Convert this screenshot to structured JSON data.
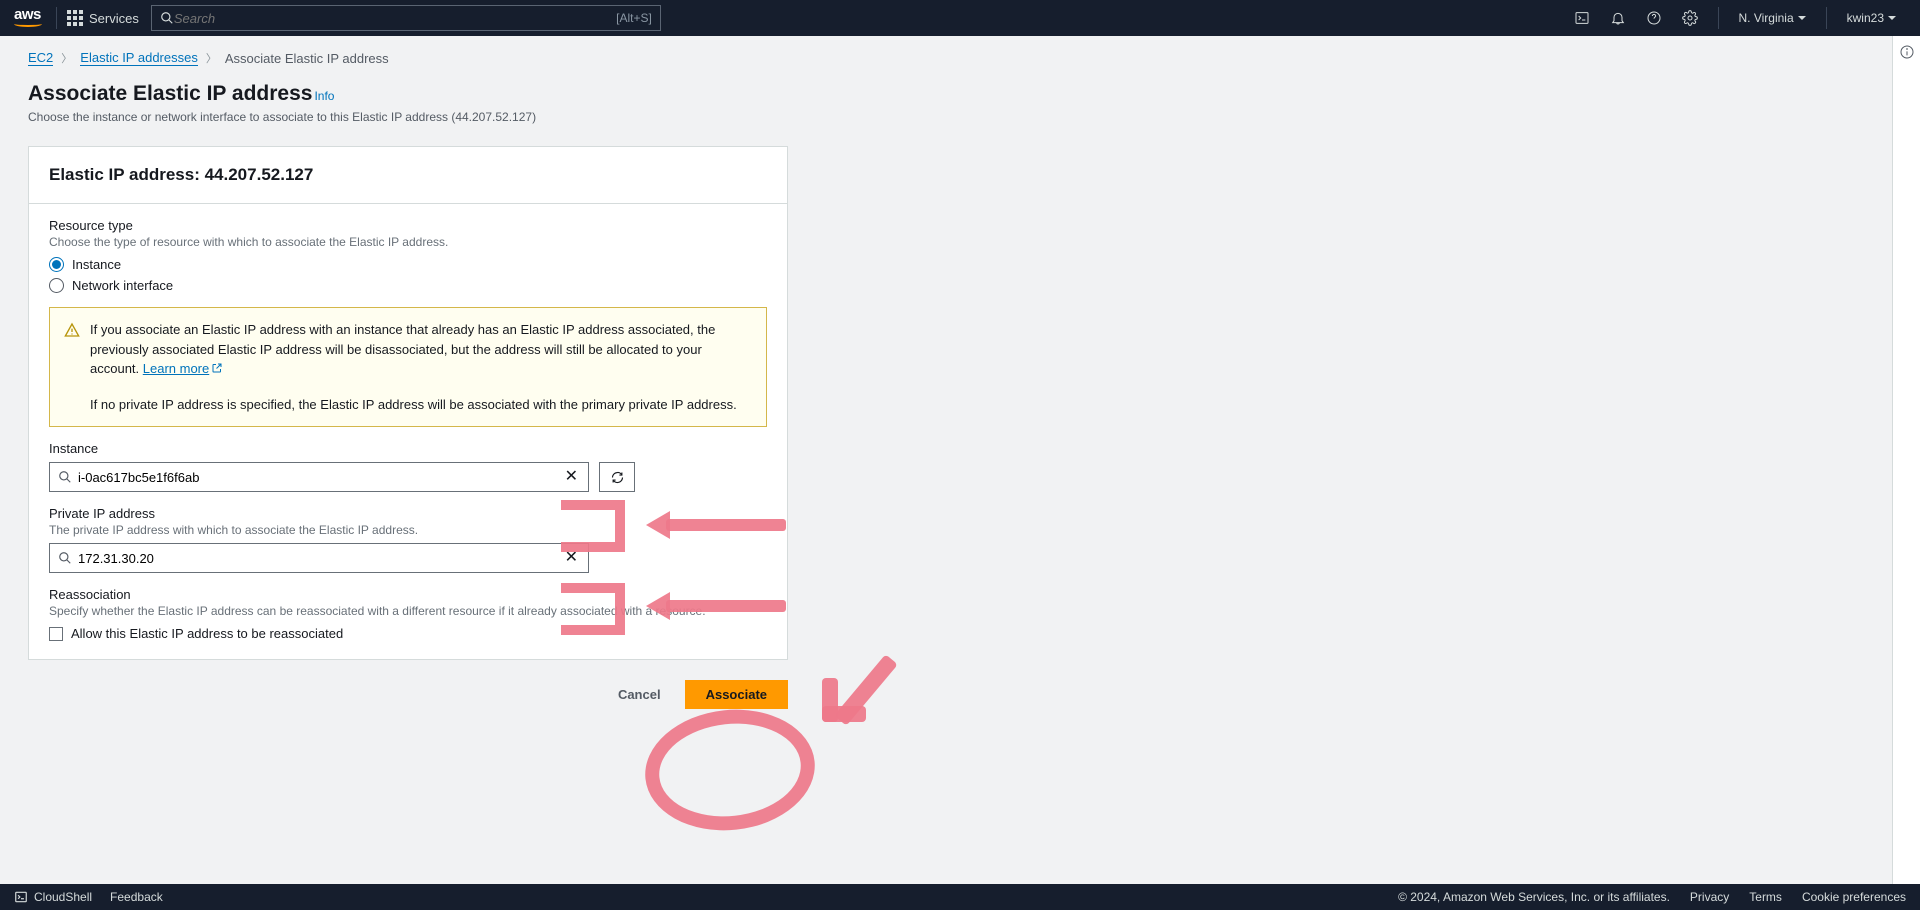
{
  "nav": {
    "services": "Services",
    "search_placeholder": "Search",
    "search_hint": "[Alt+S]",
    "region": "N. Virginia",
    "user": "kwin23"
  },
  "breadcrumb": {
    "ec2": "EC2",
    "eip": "Elastic IP addresses",
    "current": "Associate Elastic IP address"
  },
  "page": {
    "title": "Associate Elastic IP address",
    "info": "Info",
    "desc": "Choose the instance or network interface to associate to this Elastic IP address (44.207.52.127)"
  },
  "panel": {
    "header": "Elastic IP address: 44.207.52.127",
    "resource_type_label": "Resource type",
    "resource_type_hint": "Choose the type of resource with which to associate the Elastic IP address.",
    "radio_instance": "Instance",
    "radio_ni": "Network interface",
    "alert_p1": "If you associate an Elastic IP address with an instance that already has an Elastic IP address associated, the previously associated Elastic IP address will be disassociated, but the address will still be allocated to your account. ",
    "alert_learn": "Learn more",
    "alert_p2": "If no private IP address is specified, the Elastic IP address will be associated with the primary private IP address.",
    "instance_label": "Instance",
    "instance_value": "i-0ac617bc5e1f6f6ab",
    "private_label": "Private IP address",
    "private_hint": "The private IP address with which to associate the Elastic IP address.",
    "private_value": "172.31.30.20",
    "reassoc_label": "Reassociation",
    "reassoc_hint": "Specify whether the Elastic IP address can be reassociated with a different resource if it already associated with a resource.",
    "reassoc_check": "Allow this Elastic IP address to be reassociated"
  },
  "actions": {
    "cancel": "Cancel",
    "associate": "Associate"
  },
  "footer": {
    "cloudshell": "CloudShell",
    "feedback": "Feedback",
    "copyright": "© 2024, Amazon Web Services, Inc. or its affiliates.",
    "privacy": "Privacy",
    "terms": "Terms",
    "cookie": "Cookie preferences"
  }
}
